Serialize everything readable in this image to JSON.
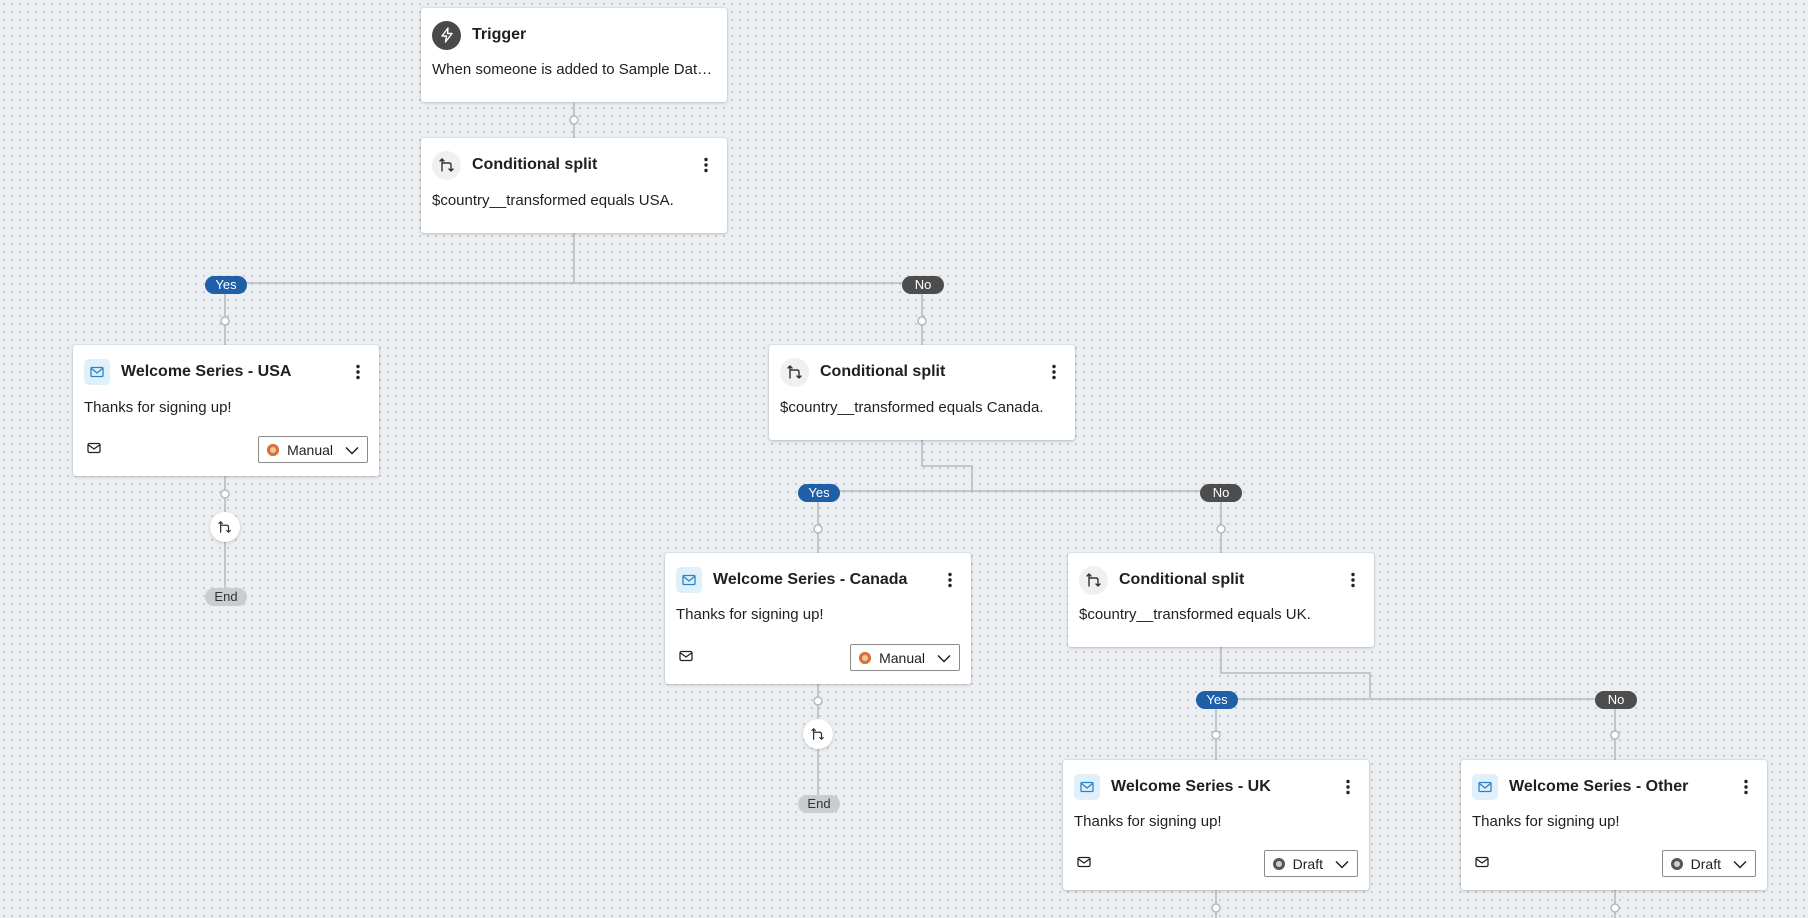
{
  "colors": {
    "canvas": "#eceff2",
    "yes_pill": "#1e5fa8",
    "no_pill": "#4d4d4d",
    "end_pill": "#c9cdd1",
    "manual_status": "#d5733a",
    "connector": "#b5b9bd"
  },
  "trigger": {
    "icon": "lightning-icon",
    "title": "Trigger",
    "description": "When someone is added to Sample Data ..."
  },
  "split_usa": {
    "icon": "split-icon",
    "title": "Conditional split",
    "condition": "$country__transformed equals USA.",
    "yes_label": "Yes",
    "no_label": "No"
  },
  "email_usa": {
    "icon": "email-icon",
    "title": "Welcome Series - USA",
    "body": "Thanks for signing up!",
    "status": "Manual",
    "end_label": "End"
  },
  "split_canada": {
    "icon": "split-icon",
    "title": "Conditional split",
    "condition": "$country__transformed equals Canada.",
    "yes_label": "Yes",
    "no_label": "No"
  },
  "email_canada": {
    "icon": "email-icon",
    "title": "Welcome Series - Canada",
    "body": "Thanks for signing up!",
    "status": "Manual",
    "end_label": "End"
  },
  "split_uk": {
    "icon": "split-icon",
    "title": "Conditional split",
    "condition": "$country__transformed equals UK.",
    "yes_label": "Yes",
    "no_label": "No"
  },
  "email_uk": {
    "icon": "email-icon",
    "title": "Welcome Series - UK",
    "body": "Thanks for signing up!",
    "status": "Draft"
  },
  "email_other": {
    "icon": "email-icon",
    "title": "Welcome Series - Other",
    "body": "Thanks for signing up!",
    "status": "Draft"
  }
}
